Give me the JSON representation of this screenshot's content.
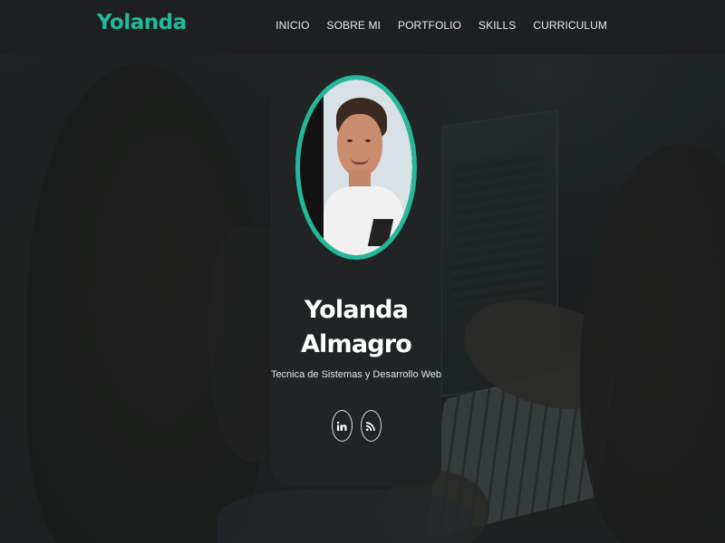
{
  "header": {
    "logo": "Yolanda",
    "nav": [
      "INICIO",
      "SOBRE MI",
      "PORTFOLIO",
      "SKILLS",
      "CURRICULUM"
    ]
  },
  "profile": {
    "name_line1": "Yolanda",
    "name_line2": "Almagro",
    "subtitle": "Tecnica de Sistemas y Desarrollo Web",
    "socials": [
      {
        "icon": "linkedin-icon"
      },
      {
        "icon": "rss-icon"
      }
    ]
  },
  "colors": {
    "accent": "#23b99a",
    "header_bg": "#1d1f20",
    "card_bg": "#202425",
    "text": "#ffffff"
  }
}
